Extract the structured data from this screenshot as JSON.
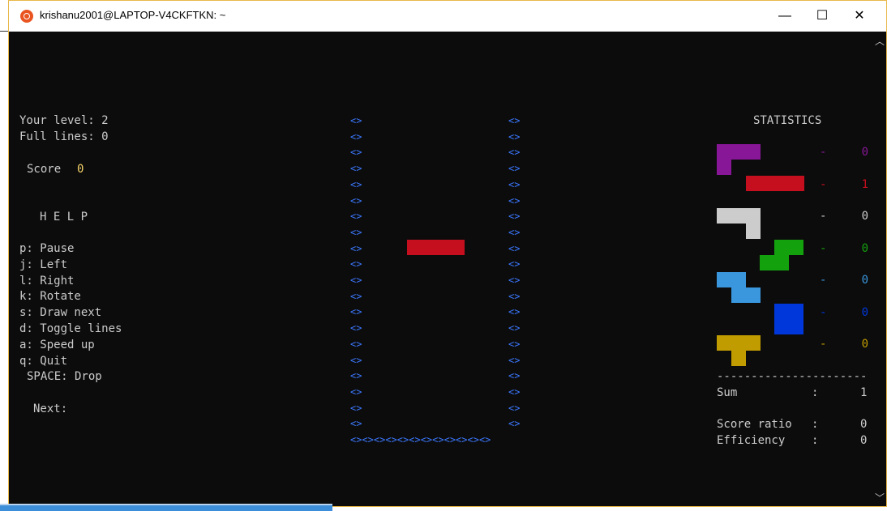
{
  "window": {
    "title": "krishanu2001@LAPTOP-V4CKFTKN: ~",
    "minimize": "—",
    "maximize": "☐",
    "close": "✕"
  },
  "left_panel": {
    "level": "Your level: 2",
    "full_lines": "Full lines: 0",
    "score_label": "Score",
    "score_value": "0",
    "help_title": "H E L P",
    "help_items": [
      "p: Pause",
      "j: Left",
      "l: Right",
      "k: Rotate",
      "s: Draw next",
      "d: Toggle lines",
      "a: Speed up",
      "q: Quit",
      "SPACE: Drop"
    ],
    "next_label": "Next:"
  },
  "board": {
    "wall_glyph": "<>",
    "floor": "<><><><><><><><><><><><>",
    "rows": 20,
    "active_piece_color": "#c50f1f"
  },
  "statistics": {
    "title": "STATISTICS",
    "pieces": [
      {
        "name": "J-piece",
        "color": "#881798",
        "count": "0",
        "dash": "-"
      },
      {
        "name": "I-piece",
        "color": "#c50f1f",
        "count": "1",
        "dash": "-"
      },
      {
        "name": "L-piece",
        "color": "#cccccc",
        "count": "0",
        "dash": "-"
      },
      {
        "name": "S-piece",
        "color": "#13a10e",
        "count": "0",
        "dash": "-"
      },
      {
        "name": "Z-piece",
        "color": "#3a96dd",
        "count": "0",
        "dash": "-"
      },
      {
        "name": "O-piece",
        "color": "#0037da",
        "count": "0",
        "dash": "-"
      },
      {
        "name": "T-piece",
        "color": "#c19c00",
        "count": "0",
        "dash": "-"
      }
    ],
    "separator": "----------------------",
    "sum_label": "Sum",
    "sum_colon": ":",
    "sum_value": "1",
    "score_ratio_label": "Score ratio",
    "score_ratio_colon": ":",
    "score_ratio_value": "0",
    "efficiency_label": "Efficiency",
    "efficiency_colon": ":",
    "efficiency_value": "0"
  }
}
